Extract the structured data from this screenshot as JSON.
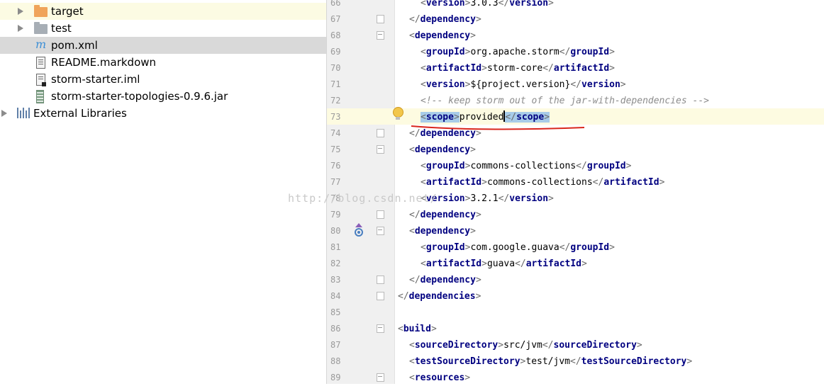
{
  "project_tree": {
    "items": [
      {
        "label": "target",
        "icon": "folder-orange-icon"
      },
      {
        "label": "test",
        "icon": "folder-icon"
      },
      {
        "label": "pom.xml",
        "icon": "maven-file-icon",
        "glyph": "m"
      },
      {
        "label": "README.markdown",
        "icon": "text-file-icon"
      },
      {
        "label": "storm-starter.iml",
        "icon": "module-file-icon"
      },
      {
        "label": "storm-starter-topologies-0.9.6.jar",
        "icon": "jar-icon"
      },
      {
        "label": "External Libraries",
        "icon": "libraries-icon"
      }
    ]
  },
  "editor": {
    "line_numbers": [
      "66",
      "67",
      "68",
      "69",
      "70",
      "71",
      "72",
      "73",
      "74",
      "75",
      "76",
      "77",
      "78",
      "79",
      "80",
      "81",
      "82",
      "83",
      "84",
      "85",
      "86",
      "87",
      "88",
      "89"
    ],
    "lines": [
      {
        "indent": 2,
        "open": "version",
        "text": "3.0.3",
        "close": "version"
      },
      {
        "indent": 1,
        "close_only": "dependency"
      },
      {
        "indent": 1,
        "open_only": "dependency"
      },
      {
        "indent": 2,
        "open": "groupId",
        "text": "org.apache.storm",
        "close": "groupId"
      },
      {
        "indent": 2,
        "open": "artifactId",
        "text": "storm-core",
        "close": "artifactId"
      },
      {
        "indent": 2,
        "open": "version",
        "text": "${project.version}",
        "close": "version"
      },
      {
        "indent": 2,
        "comment": "<!-- keep storm out of the jar-with-dependencies -->"
      },
      {
        "indent": 2,
        "open": "scope",
        "text": "provided",
        "close": "scope",
        "selected": true
      },
      {
        "indent": 1,
        "close_only": "dependency"
      },
      {
        "indent": 1,
        "open_only": "dependency"
      },
      {
        "indent": 2,
        "open": "groupId",
        "text": "commons-collections",
        "close": "groupId"
      },
      {
        "indent": 2,
        "open": "artifactId",
        "text": "commons-collections",
        "close": "artifactId"
      },
      {
        "indent": 2,
        "open": "version",
        "text": "3.2.1",
        "close": "version"
      },
      {
        "indent": 1,
        "close_only": "dependency"
      },
      {
        "indent": 1,
        "open_only": "dependency"
      },
      {
        "indent": 2,
        "open": "groupId",
        "text": "com.google.guava",
        "close": "groupId"
      },
      {
        "indent": 2,
        "open": "artifactId",
        "text": "guava",
        "close": "artifactId"
      },
      {
        "indent": 1,
        "close_only": "dependency"
      },
      {
        "indent": 0,
        "close_only": "dependencies"
      },
      {
        "indent": 0,
        "blank": true
      },
      {
        "indent": 0,
        "open_only": "build"
      },
      {
        "indent": 1,
        "open": "sourceDirectory",
        "text": "src/jvm",
        "close": "sourceDirectory"
      },
      {
        "indent": 1,
        "open": "testSourceDirectory",
        "text": "test/jvm",
        "close": "testSourceDirectory"
      },
      {
        "indent": 1,
        "open_only": "resources"
      }
    ],
    "fold_marker_lines": [
      "67",
      "68",
      "74",
      "75",
      "79",
      "80",
      "83",
      "84",
      "86",
      "89"
    ],
    "current_line": "73",
    "gutter_icons": [
      {
        "line": "73",
        "icon": "lightbulb-icon"
      },
      {
        "line": "80",
        "icon": "implemented-up-arrow-icon"
      }
    ]
  },
  "watermark": "http://blog.csdn.net/",
  "colors": {
    "tag": "#000080",
    "selection": "#a8cce9",
    "current_line": "#fdfbe1",
    "annotation_underline": "#d9261c"
  }
}
